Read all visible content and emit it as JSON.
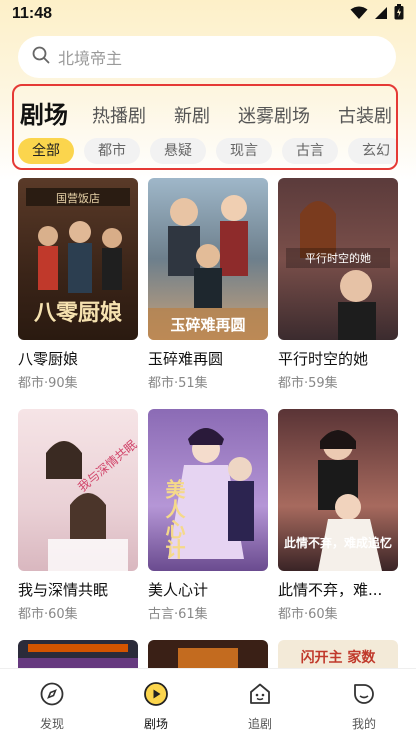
{
  "status": {
    "time": "11:48"
  },
  "search": {
    "placeholder": "北境帝主"
  },
  "tabs": [
    {
      "label": "剧场",
      "active": true
    },
    {
      "label": "热播剧",
      "active": false
    },
    {
      "label": "新剧",
      "active": false
    },
    {
      "label": "迷雾剧场",
      "active": false
    },
    {
      "label": "古装剧",
      "active": false
    }
  ],
  "chips": [
    {
      "label": "全部",
      "active": true
    },
    {
      "label": "都市",
      "active": false
    },
    {
      "label": "悬疑",
      "active": false
    },
    {
      "label": "现言",
      "active": false
    },
    {
      "label": "古言",
      "active": false
    },
    {
      "label": "玄幻",
      "active": false
    }
  ],
  "dramas": [
    {
      "title": "八零厨娘",
      "meta": "都市·90集",
      "poster_text": "八零厨娘",
      "poster_top_text": "国营饭店"
    },
    {
      "title": "玉碎难再圆",
      "meta": "都市·51集",
      "poster_text": "玉碎难再圆"
    },
    {
      "title": "平行时空的她",
      "meta": "都市·59集",
      "poster_text": "平行时空的她"
    },
    {
      "title": "我与深情共眠",
      "meta": "都市·60集",
      "poster_text": "我与深情共眠"
    },
    {
      "title": "美人心计",
      "meta": "古言·61集",
      "poster_text": "美人心计"
    },
    {
      "title": "此情不弃，难...",
      "meta": "都市·60集",
      "poster_text": "此情不弃，难成追忆"
    }
  ],
  "partial_posters": [
    {
      "poster_text": ""
    },
    {
      "poster_text": ""
    },
    {
      "poster_text": "闪开主 家数"
    }
  ],
  "nav": [
    {
      "label": "发现",
      "icon": "compass-icon",
      "active": false
    },
    {
      "label": "剧场",
      "icon": "play-icon",
      "active": true
    },
    {
      "label": "追剧",
      "icon": "house-heart-icon",
      "active": false
    },
    {
      "label": "我的",
      "icon": "profile-icon",
      "active": false
    }
  ],
  "colors": {
    "accent": "#fbd54d",
    "highlight_border": "#e53935",
    "header_bg": "#fdf0c8"
  }
}
